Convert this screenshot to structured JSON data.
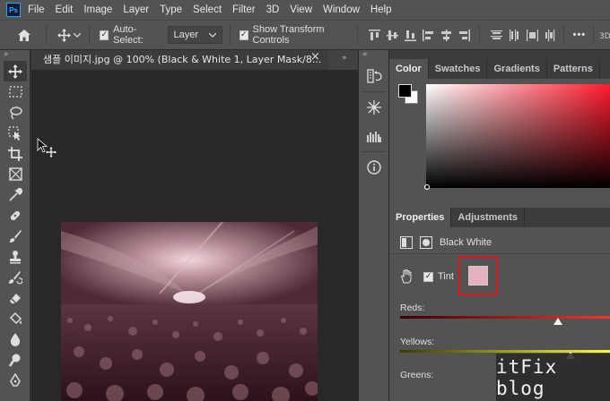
{
  "app": {
    "logo_text": "Ps"
  },
  "menu": [
    "File",
    "Edit",
    "Image",
    "Layer",
    "Type",
    "Select",
    "Filter",
    "3D",
    "View",
    "Window",
    "Help"
  ],
  "options": {
    "auto_select_label": "Auto-Select:",
    "auto_select_checked": true,
    "auto_select_value": "Layer",
    "show_transform_label": "Show Transform Controls",
    "show_transform_checked": true,
    "more_label": "•••"
  },
  "document": {
    "tab_title": "샘플 이미지.jpg @ 100% (Black & White 1, Layer Mask/8...",
    "close_glyph": "×"
  },
  "color_panel": {
    "tabs": [
      "Color",
      "Swatches",
      "Gradients",
      "Patterns"
    ],
    "active_tab": "Color",
    "foreground": "#000000",
    "background": "#ffffff",
    "hue_color": "#ff1b2d"
  },
  "properties_panel": {
    "tabs": [
      "Properties",
      "Adjustments"
    ],
    "active_tab": "Properties",
    "adjustment_name": "Black  White",
    "tint_label": "Tint",
    "tint_checked": true,
    "tint_color": "#e3b2bd",
    "sliders": [
      {
        "label": "Reds:",
        "value_fraction": 0.75,
        "gradient": [
          "#3a0000",
          "#ff3030"
        ]
      },
      {
        "label": "Yellows:",
        "value_fraction": 0.81,
        "gradient": [
          "#3a3a00",
          "#ffff33"
        ]
      },
      {
        "label": "Greens:"
      }
    ]
  },
  "watermark": "itFix blog"
}
